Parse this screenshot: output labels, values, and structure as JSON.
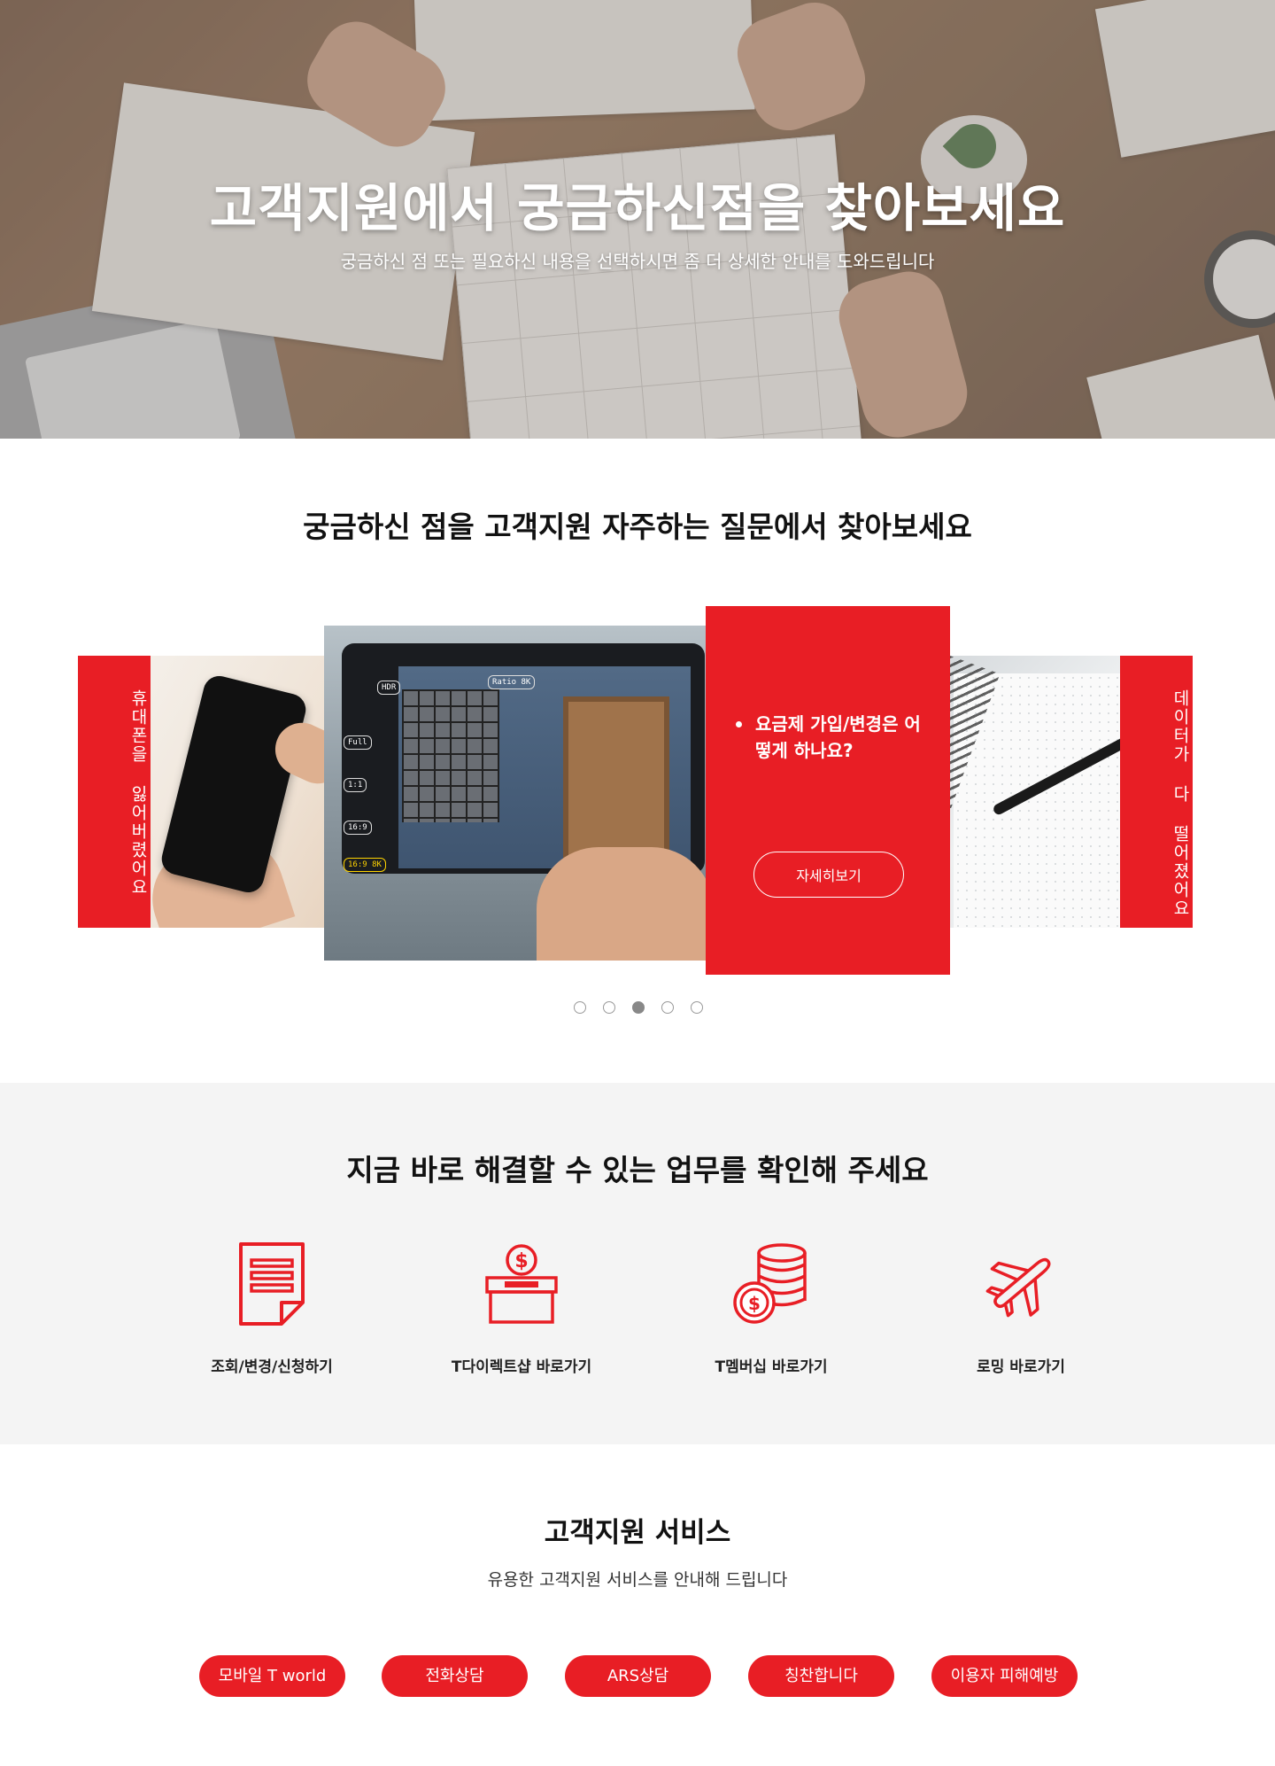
{
  "hero": {
    "title": "고객지원에서 궁금하신점을 찾아보세요",
    "subtitle": "궁금하신 점 또는 필요하신 내용을 선택하시면 좀 더 상세한 안내를 도와드립니다"
  },
  "faq": {
    "title": "궁금하신 점을 고객지원 자주하는 질문에서 찾아보세요",
    "left_tab": "휴대폰을 잃어버렸어요",
    "right_tab": "데이터가 다 떨어졌어요",
    "active_question": "요금제 가입/변경은 어떻게 하나요?",
    "more_button": "자세히보기",
    "camera_labels": [
      "HDR",
      "Ratio 8K",
      "Full",
      "1:1",
      "16:9",
      "16:9 8K"
    ],
    "slide_count": 5,
    "active_slide": 3
  },
  "tasks": {
    "title": "지금 바로 해결할 수 있는 업무를 확인해 주세요",
    "items": [
      {
        "label": "조회/변경/신청하기",
        "icon": "document-icon"
      },
      {
        "label": "T다이렉트샵 바로가기",
        "icon": "coin-box-icon"
      },
      {
        "label": "T멤버십 바로가기",
        "icon": "coin-stack-icon"
      },
      {
        "label": "로밍 바로가기",
        "icon": "airplane-icon"
      }
    ]
  },
  "services": {
    "title": "고객지원 서비스",
    "subtitle": "유용한 고객지원 서비스를 안내해 드립니다",
    "buttons": [
      "모바일 T world",
      "전화상담",
      "ARS상담",
      "칭찬합니다",
      "이용자 피해예방"
    ]
  },
  "colors": {
    "accent": "#e81e25",
    "section_bg": "#f4f4f4"
  }
}
